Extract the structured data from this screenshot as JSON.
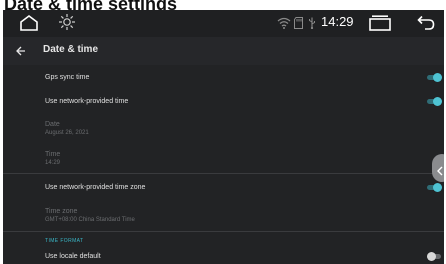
{
  "caption": "Date & time settings",
  "statusbar": {
    "home_icon": "home-outline-icon",
    "settings_icon": "gear-icon",
    "wifi_icon": "wifi-icon",
    "sd_icon": "sd-card-icon",
    "usb_icon": "usb-icon",
    "time": "14:29",
    "recents_icon": "recent-apps-icon",
    "back_icon": "back-arrow-icon"
  },
  "appbar": {
    "title": "Date & time",
    "back_icon": "arrow-left-icon"
  },
  "settings": {
    "gps_sync": {
      "title": "Gps sync time",
      "enabled": true
    },
    "network_time": {
      "title": "Use network-provided time",
      "enabled": true
    },
    "date": {
      "title": "Date",
      "value": "August 26, 2021"
    },
    "time": {
      "title": "Time",
      "value": "14:29"
    },
    "network_zone": {
      "title": "Use network-provided time zone",
      "enabled": true
    },
    "time_zone": {
      "title": "Time zone",
      "value": "GMT+08:00 China Standard Time"
    },
    "section_time_format": "TIME FORMAT",
    "locale_default": {
      "title": "Use locale default",
      "enabled": false
    }
  },
  "colors": {
    "accent": "#4ec3d3",
    "background": "#222325",
    "text_primary": "#e0e0e0",
    "text_disabled": "#6b6d70"
  }
}
